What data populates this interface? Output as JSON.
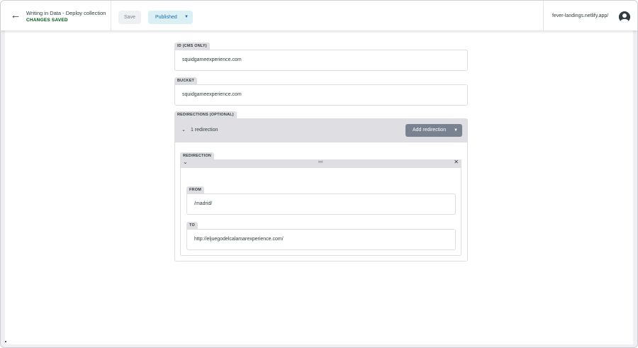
{
  "header": {
    "back_icon": "arrow-left-icon",
    "entry_title": "Writing in Data - Deploy collection",
    "entry_status": "CHANGES SAVED",
    "save_label": "Save",
    "publish_label": "Published",
    "site_url": "fever-landings.netlify.app/",
    "avatar_icon": "user-avatar-icon"
  },
  "fields": {
    "id": {
      "label": "ID (CMS ONLY)",
      "value": "squidgameexperience.com"
    },
    "bucket": {
      "label": "BUCKET",
      "value": "squidgameexperience.com"
    },
    "redirections": {
      "label": "REDIRECTIONS (OPTIONAL)",
      "count_label": "1 redirection",
      "add_label": "Add redirection",
      "items": [
        {
          "label": "REDIRECTION",
          "from": {
            "label": "FROM",
            "value": "/madrid/"
          },
          "to": {
            "label": "TO",
            "value": "http://eljuegodelcalamarexperience.com/"
          }
        }
      ]
    }
  },
  "colors": {
    "accent_green": "#005614",
    "publish_bg": "#dbf0f5",
    "publish_text": "#1e6ab4",
    "label_bg": "#dfdfe3",
    "add_button_bg": "#798291"
  }
}
